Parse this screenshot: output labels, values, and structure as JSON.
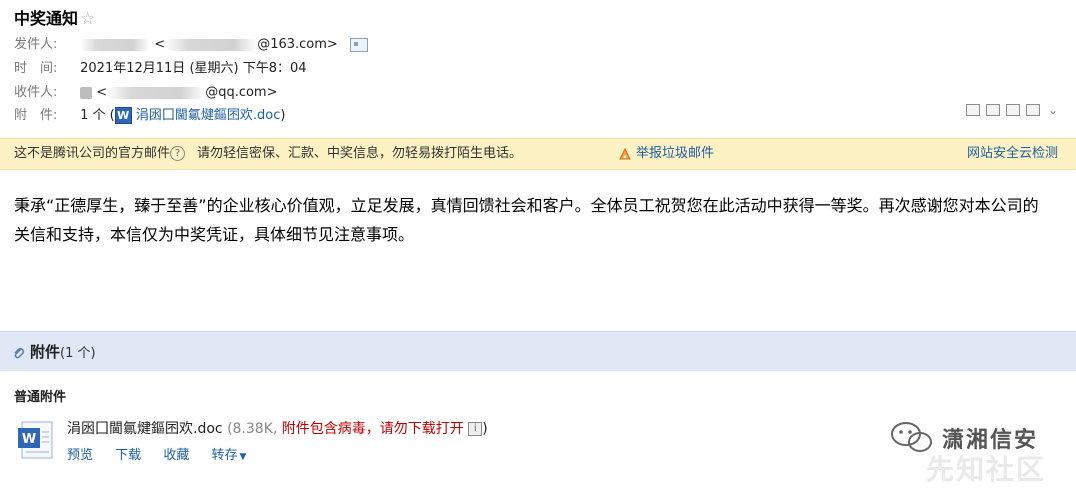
{
  "email": {
    "subject": "中奖通知",
    "star_icon": "star-icon",
    "sender_label": "发件人:",
    "sender_address_suffix": "@163.com>",
    "sender_address_prefix": "<",
    "time_label": "时　间:",
    "time_value": "2021年12月11日 (星期六) 下午8：04",
    "recipient_label": "收件人:",
    "recipient_address_prefix": "<",
    "recipient_address_suffix": "@qq.com>",
    "attachment_label": "附　件:",
    "attachment_count": "1 个 (",
    "attachment_name": "涓囦囗閫氱煡鏂囨欢.doc",
    "attachment_close": ")"
  },
  "warning": {
    "text": "这不是腾讯公司的官方邮件",
    "advice": "请勿轻信密保、汇款、中奖信息，勿轻易拨打陌生电话。",
    "report_link": "举报垃圾邮件",
    "cloud_check": "网站安全云检测"
  },
  "body": {
    "text": "秉承“正德厚生，臻于至善”的企业核心价值观，立足发展，真情回馈社会和客户。全体员工祝贺您在此活动中获得一等奖。再次感谢您对本公司的关信和支持，本信仅为中奖凭证，具体细节见注意事项。"
  },
  "attachments": {
    "title": "附件",
    "count": "(1 个)",
    "section_label": "普通附件",
    "file": {
      "name": "涓囦囗閫氱煡鏂囨欢.doc",
      "size": "(8.38K,",
      "virus_warning": "附件包含病毒，请勿下载打开",
      "close": ")",
      "actions": [
        "预览",
        "下载",
        "收藏",
        "转存"
      ]
    }
  },
  "watermark": {
    "name": "潇湘信安",
    "sub": "先知社区"
  }
}
